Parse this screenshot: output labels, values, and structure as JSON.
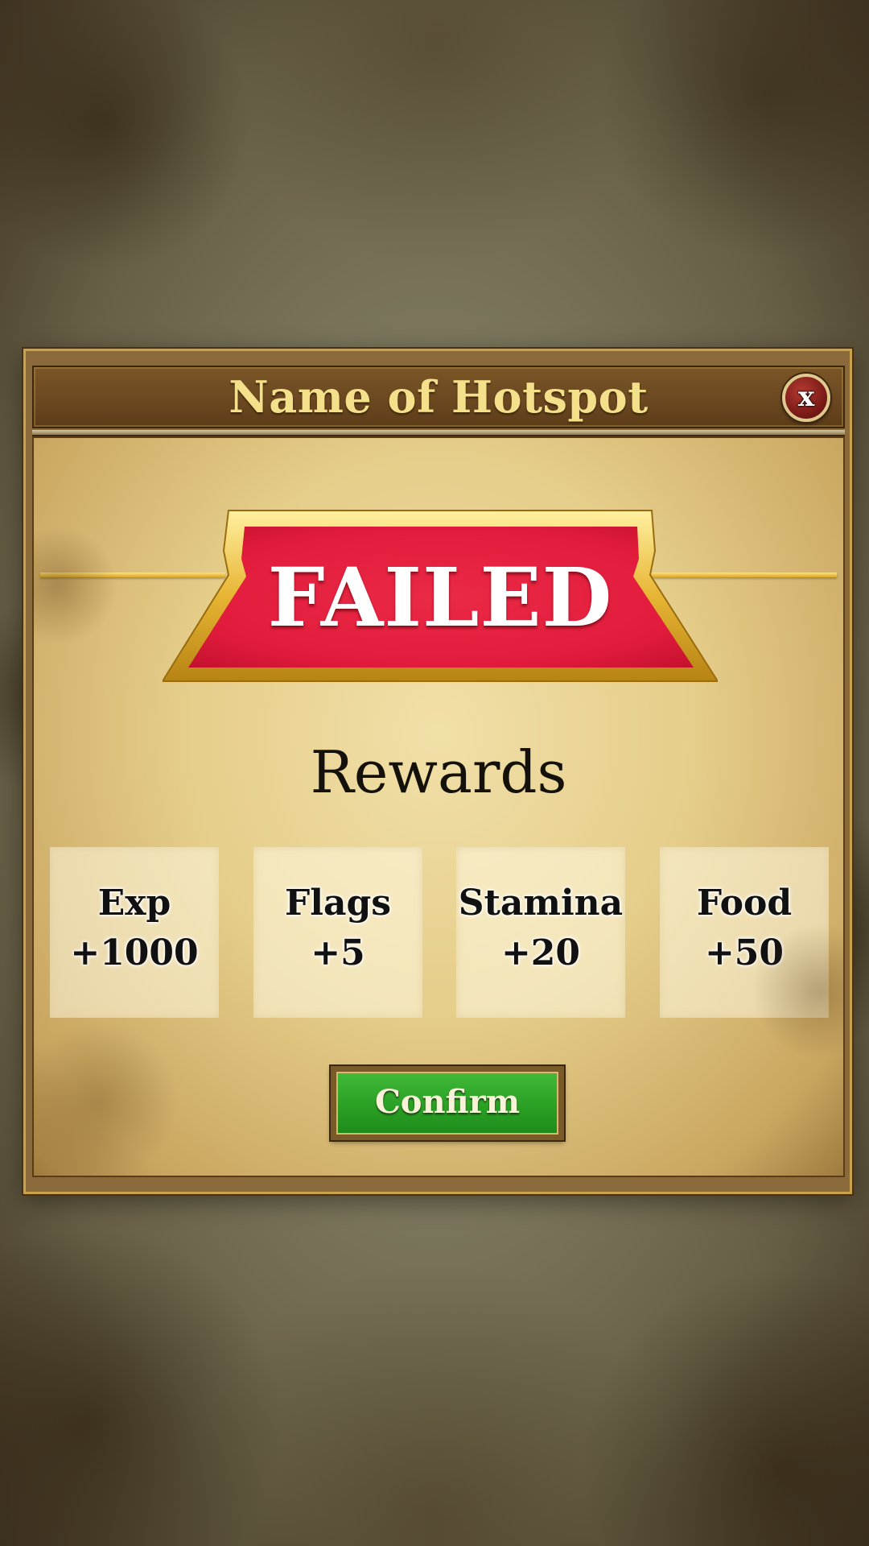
{
  "dialog": {
    "title": "Name of Hotspot",
    "close_label": "x",
    "result_label": "FAILED",
    "rewards_heading": "Rewards",
    "rewards": [
      {
        "label": "Exp",
        "value": "+1000"
      },
      {
        "label": "Flags",
        "value": "+5"
      },
      {
        "label": "Stamina",
        "value": "+20"
      },
      {
        "label": "Food",
        "value": "+50"
      }
    ],
    "confirm_label": "Confirm"
  },
  "colors": {
    "title_text": "#f4e08a",
    "banner_red": "#e21b3c",
    "banner_gold": "#e7b533",
    "confirm_green": "#2aa124",
    "close_red": "#7d1c18"
  }
}
